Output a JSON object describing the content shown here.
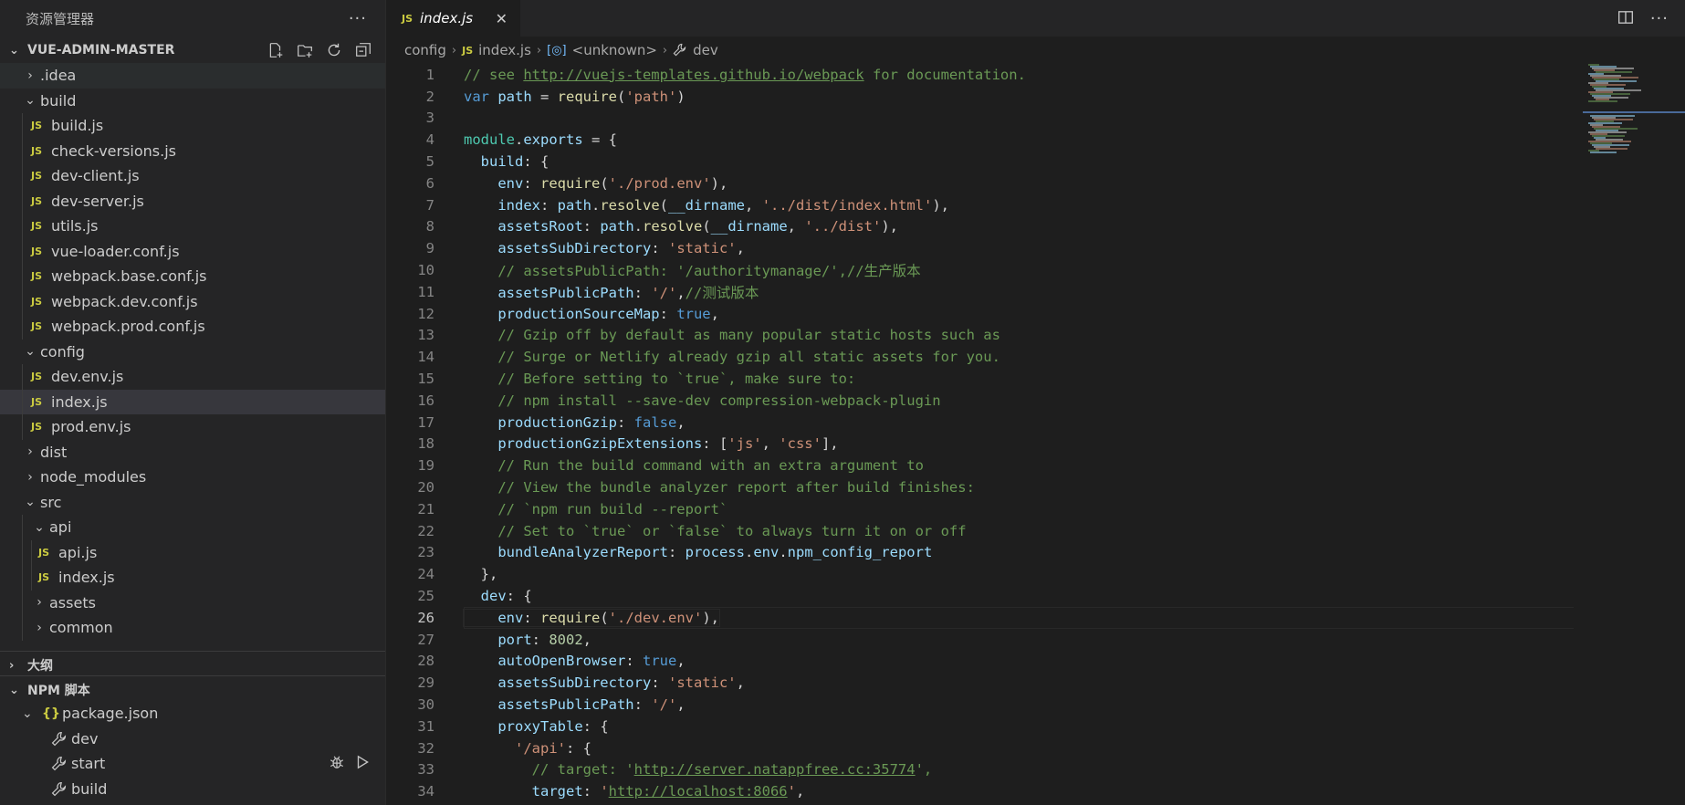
{
  "sidebar": {
    "title": "资源管理器",
    "more": "···",
    "project": "VUE-ADMIN-MASTER",
    "tree": [
      {
        "label": ".idea",
        "kind": "folder",
        "open": false,
        "depth": 1
      },
      {
        "label": "build",
        "kind": "folder",
        "open": true,
        "depth": 1
      },
      {
        "label": "build.js",
        "kind": "js",
        "depth": 2
      },
      {
        "label": "check-versions.js",
        "kind": "js",
        "depth": 2
      },
      {
        "label": "dev-client.js",
        "kind": "js",
        "depth": 2
      },
      {
        "label": "dev-server.js",
        "kind": "js",
        "depth": 2
      },
      {
        "label": "utils.js",
        "kind": "js",
        "depth": 2
      },
      {
        "label": "vue-loader.conf.js",
        "kind": "js",
        "depth": 2
      },
      {
        "label": "webpack.base.conf.js",
        "kind": "js",
        "depth": 2
      },
      {
        "label": "webpack.dev.conf.js",
        "kind": "js",
        "depth": 2
      },
      {
        "label": "webpack.prod.conf.js",
        "kind": "js",
        "depth": 2
      },
      {
        "label": "config",
        "kind": "folder",
        "open": true,
        "depth": 1
      },
      {
        "label": "dev.env.js",
        "kind": "js",
        "depth": 2
      },
      {
        "label": "index.js",
        "kind": "js",
        "depth": 2,
        "selected": true
      },
      {
        "label": "prod.env.js",
        "kind": "js",
        "depth": 2
      },
      {
        "label": "dist",
        "kind": "folder",
        "open": false,
        "depth": 1
      },
      {
        "label": "node_modules",
        "kind": "folder",
        "open": false,
        "depth": 1
      },
      {
        "label": "src",
        "kind": "folder",
        "open": true,
        "depth": 1
      },
      {
        "label": "api",
        "kind": "folder",
        "open": true,
        "depth": 2
      },
      {
        "label": "api.js",
        "kind": "js",
        "depth": 3
      },
      {
        "label": "index.js",
        "kind": "js",
        "depth": 3
      },
      {
        "label": "assets",
        "kind": "folder",
        "open": false,
        "depth": 2
      },
      {
        "label": "common",
        "kind": "folder",
        "open": false,
        "depth": 2
      }
    ],
    "outline_title": "大纲",
    "npm_title": "NPM 脚本",
    "npm": {
      "package": "package.json",
      "scripts": [
        "dev",
        "start",
        "build"
      ]
    }
  },
  "editor": {
    "tab": {
      "icon": "JS",
      "name": "index.js"
    },
    "breadcrumb": {
      "folder": "config",
      "file": "index.js",
      "symbol": "<unknown>",
      "leaf": "dev"
    },
    "active_line": 26,
    "lines": [
      {
        "n": "1",
        "seg": [
          [
            "com",
            "// see "
          ],
          [
            "link",
            "http://vuejs-templates.github.io/webpack"
          ],
          [
            "com",
            " for documentation."
          ]
        ]
      },
      {
        "n": "2",
        "seg": [
          [
            "kw",
            "var "
          ],
          [
            "var",
            "path"
          ],
          [
            "plain",
            " = "
          ],
          [
            "fn",
            "require"
          ],
          [
            "plain",
            "("
          ],
          [
            "str",
            "'path'"
          ],
          [
            "plain",
            ")"
          ]
        ]
      },
      {
        "n": "3",
        "seg": []
      },
      {
        "n": "4",
        "seg": [
          [
            "obj",
            "module"
          ],
          [
            "plain",
            "."
          ],
          [
            "var",
            "exports"
          ],
          [
            "plain",
            " = {"
          ]
        ]
      },
      {
        "n": "5",
        "seg": [
          [
            "plain",
            "  "
          ],
          [
            "key",
            "build"
          ],
          [
            "plain",
            ": {"
          ]
        ]
      },
      {
        "n": "6",
        "seg": [
          [
            "plain",
            "    "
          ],
          [
            "key",
            "env"
          ],
          [
            "plain",
            ": "
          ],
          [
            "fn",
            "require"
          ],
          [
            "plain",
            "("
          ],
          [
            "str",
            "'./prod.env'"
          ],
          [
            "plain",
            "),"
          ]
        ]
      },
      {
        "n": "7",
        "seg": [
          [
            "plain",
            "    "
          ],
          [
            "key",
            "index"
          ],
          [
            "plain",
            ": "
          ],
          [
            "var",
            "path"
          ],
          [
            "plain",
            "."
          ],
          [
            "fn",
            "resolve"
          ],
          [
            "plain",
            "("
          ],
          [
            "var",
            "__dirname"
          ],
          [
            "plain",
            ", "
          ],
          [
            "str",
            "'../dist/index.html'"
          ],
          [
            "plain",
            "),"
          ]
        ]
      },
      {
        "n": "8",
        "seg": [
          [
            "plain",
            "    "
          ],
          [
            "key",
            "assetsRoot"
          ],
          [
            "plain",
            ": "
          ],
          [
            "var",
            "path"
          ],
          [
            "plain",
            "."
          ],
          [
            "fn",
            "resolve"
          ],
          [
            "plain",
            "("
          ],
          [
            "var",
            "__dirname"
          ],
          [
            "plain",
            ", "
          ],
          [
            "str",
            "'../dist'"
          ],
          [
            "plain",
            "),"
          ]
        ]
      },
      {
        "n": "9",
        "seg": [
          [
            "plain",
            "    "
          ],
          [
            "key",
            "assetsSubDirectory"
          ],
          [
            "plain",
            ": "
          ],
          [
            "str",
            "'static'"
          ],
          [
            "plain",
            ","
          ]
        ]
      },
      {
        "n": "10",
        "seg": [
          [
            "plain",
            "    "
          ],
          [
            "com",
            "// assetsPublicPath: '/authoritymanage/',//生产版本"
          ]
        ]
      },
      {
        "n": "11",
        "seg": [
          [
            "plain",
            "    "
          ],
          [
            "key",
            "assetsPublicPath"
          ],
          [
            "plain",
            ": "
          ],
          [
            "str",
            "'/'"
          ],
          [
            "plain",
            ","
          ],
          [
            "com",
            "//测试版本"
          ]
        ]
      },
      {
        "n": "12",
        "seg": [
          [
            "plain",
            "    "
          ],
          [
            "key",
            "productionSourceMap"
          ],
          [
            "plain",
            ": "
          ],
          [
            "kw",
            "true"
          ],
          [
            "plain",
            ","
          ]
        ]
      },
      {
        "n": "13",
        "seg": [
          [
            "plain",
            "    "
          ],
          [
            "com",
            "// Gzip off by default as many popular static hosts such as"
          ]
        ]
      },
      {
        "n": "14",
        "seg": [
          [
            "plain",
            "    "
          ],
          [
            "com",
            "// Surge or Netlify already gzip all static assets for you."
          ]
        ]
      },
      {
        "n": "15",
        "seg": [
          [
            "plain",
            "    "
          ],
          [
            "com",
            "// Before setting to `true`, make sure to:"
          ]
        ]
      },
      {
        "n": "16",
        "seg": [
          [
            "plain",
            "    "
          ],
          [
            "com",
            "// npm install --save-dev compression-webpack-plugin"
          ]
        ]
      },
      {
        "n": "17",
        "seg": [
          [
            "plain",
            "    "
          ],
          [
            "key",
            "productionGzip"
          ],
          [
            "plain",
            ": "
          ],
          [
            "kw",
            "false"
          ],
          [
            "plain",
            ","
          ]
        ]
      },
      {
        "n": "18",
        "seg": [
          [
            "plain",
            "    "
          ],
          [
            "key",
            "productionGzipExtensions"
          ],
          [
            "plain",
            ": ["
          ],
          [
            "str",
            "'js'"
          ],
          [
            "plain",
            ", "
          ],
          [
            "str",
            "'css'"
          ],
          [
            "plain",
            "],"
          ]
        ]
      },
      {
        "n": "19",
        "seg": [
          [
            "plain",
            "    "
          ],
          [
            "com",
            "// Run the build command with an extra argument to"
          ]
        ]
      },
      {
        "n": "20",
        "seg": [
          [
            "plain",
            "    "
          ],
          [
            "com",
            "// View the bundle analyzer report after build finishes:"
          ]
        ]
      },
      {
        "n": "21",
        "seg": [
          [
            "plain",
            "    "
          ],
          [
            "com",
            "// `npm run build --report`"
          ]
        ]
      },
      {
        "n": "22",
        "seg": [
          [
            "plain",
            "    "
          ],
          [
            "com",
            "// Set to `true` or `false` to always turn it on or off"
          ]
        ]
      },
      {
        "n": "23",
        "seg": [
          [
            "plain",
            "    "
          ],
          [
            "key",
            "bundleAnalyzerReport"
          ],
          [
            "plain",
            ": "
          ],
          [
            "var",
            "process"
          ],
          [
            "plain",
            "."
          ],
          [
            "var",
            "env"
          ],
          [
            "plain",
            "."
          ],
          [
            "var",
            "npm_config_report"
          ]
        ]
      },
      {
        "n": "24",
        "seg": [
          [
            "plain",
            "  },"
          ]
        ]
      },
      {
        "n": "25",
        "seg": [
          [
            "plain",
            "  "
          ],
          [
            "key",
            "dev"
          ],
          [
            "plain",
            ": {"
          ]
        ]
      },
      {
        "n": "26",
        "seg": [
          [
            "plain",
            "    "
          ],
          [
            "key",
            "env"
          ],
          [
            "plain",
            ": "
          ],
          [
            "fn",
            "require"
          ],
          [
            "plain",
            "("
          ],
          [
            "str",
            "'./dev.env'"
          ],
          [
            "plain",
            "),"
          ]
        ]
      },
      {
        "n": "27",
        "seg": [
          [
            "plain",
            "    "
          ],
          [
            "key",
            "port"
          ],
          [
            "plain",
            ": "
          ],
          [
            "num",
            "8002"
          ],
          [
            "plain",
            ","
          ]
        ]
      },
      {
        "n": "28",
        "seg": [
          [
            "plain",
            "    "
          ],
          [
            "key",
            "autoOpenBrowser"
          ],
          [
            "plain",
            ": "
          ],
          [
            "kw",
            "true"
          ],
          [
            "plain",
            ","
          ]
        ]
      },
      {
        "n": "29",
        "seg": [
          [
            "plain",
            "    "
          ],
          [
            "key",
            "assetsSubDirectory"
          ],
          [
            "plain",
            ": "
          ],
          [
            "str",
            "'static'"
          ],
          [
            "plain",
            ","
          ]
        ]
      },
      {
        "n": "30",
        "seg": [
          [
            "plain",
            "    "
          ],
          [
            "key",
            "assetsPublicPath"
          ],
          [
            "plain",
            ": "
          ],
          [
            "str",
            "'/'"
          ],
          [
            "plain",
            ","
          ]
        ]
      },
      {
        "n": "31",
        "seg": [
          [
            "plain",
            "    "
          ],
          [
            "key",
            "proxyTable"
          ],
          [
            "plain",
            ": {"
          ]
        ]
      },
      {
        "n": "32",
        "seg": [
          [
            "plain",
            "      "
          ],
          [
            "str",
            "'/api'"
          ],
          [
            "plain",
            ": {"
          ]
        ]
      },
      {
        "n": "33",
        "seg": [
          [
            "plain",
            "        "
          ],
          [
            "com",
            "// target: '"
          ],
          [
            "link",
            "http://server.natappfree.cc:35774"
          ],
          [
            "com",
            "',"
          ]
        ]
      },
      {
        "n": "34",
        "seg": [
          [
            "plain",
            "        "
          ],
          [
            "key",
            "target"
          ],
          [
            "plain",
            ": "
          ],
          [
            "str",
            "'"
          ],
          [
            "link",
            "http://localhost:8066"
          ],
          [
            "str",
            "'"
          ],
          [
            "plain",
            ","
          ]
        ]
      }
    ]
  },
  "colors": {
    "accent": "#007acc",
    "js_icon": "#cbcb41",
    "comment": "#6a9955",
    "string": "#ce9178",
    "keyword": "#569cd6"
  }
}
